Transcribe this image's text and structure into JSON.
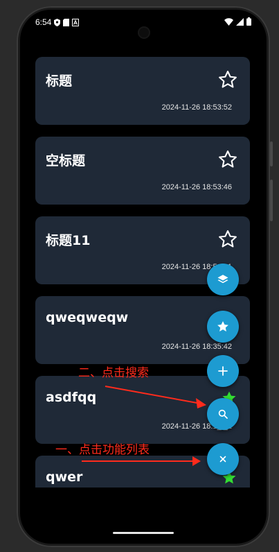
{
  "status_bar": {
    "time": "6:54"
  },
  "notes": [
    {
      "title": "标题",
      "time": "2024-11-26 18:53:52",
      "starred": false
    },
    {
      "title": "空标题",
      "time": "2024-11-26 18:53:46",
      "starred": false
    },
    {
      "title": "标题11",
      "time": "2024-11-26 18:5_:_1",
      "starred": false
    },
    {
      "title": "qweqweqw",
      "time": "2024-11-26 18:35:42",
      "starred": false
    },
    {
      "title": "asdfqq",
      "time": "2024-11-26 18:1_:_1",
      "starred": true
    },
    {
      "title": "qwer",
      "time": "",
      "starred": true
    }
  ],
  "fab_menu": {
    "items": [
      "layers",
      "favorites",
      "add",
      "search",
      "close"
    ]
  },
  "annotations": {
    "step_two": "二、点击搜索",
    "step_one": "一、点击功能列表"
  },
  "colors": {
    "card_bg": "#1f2937",
    "fab": "#1d9bd1",
    "star_active": "#33dd33",
    "annotation": "#ff2b1c"
  }
}
